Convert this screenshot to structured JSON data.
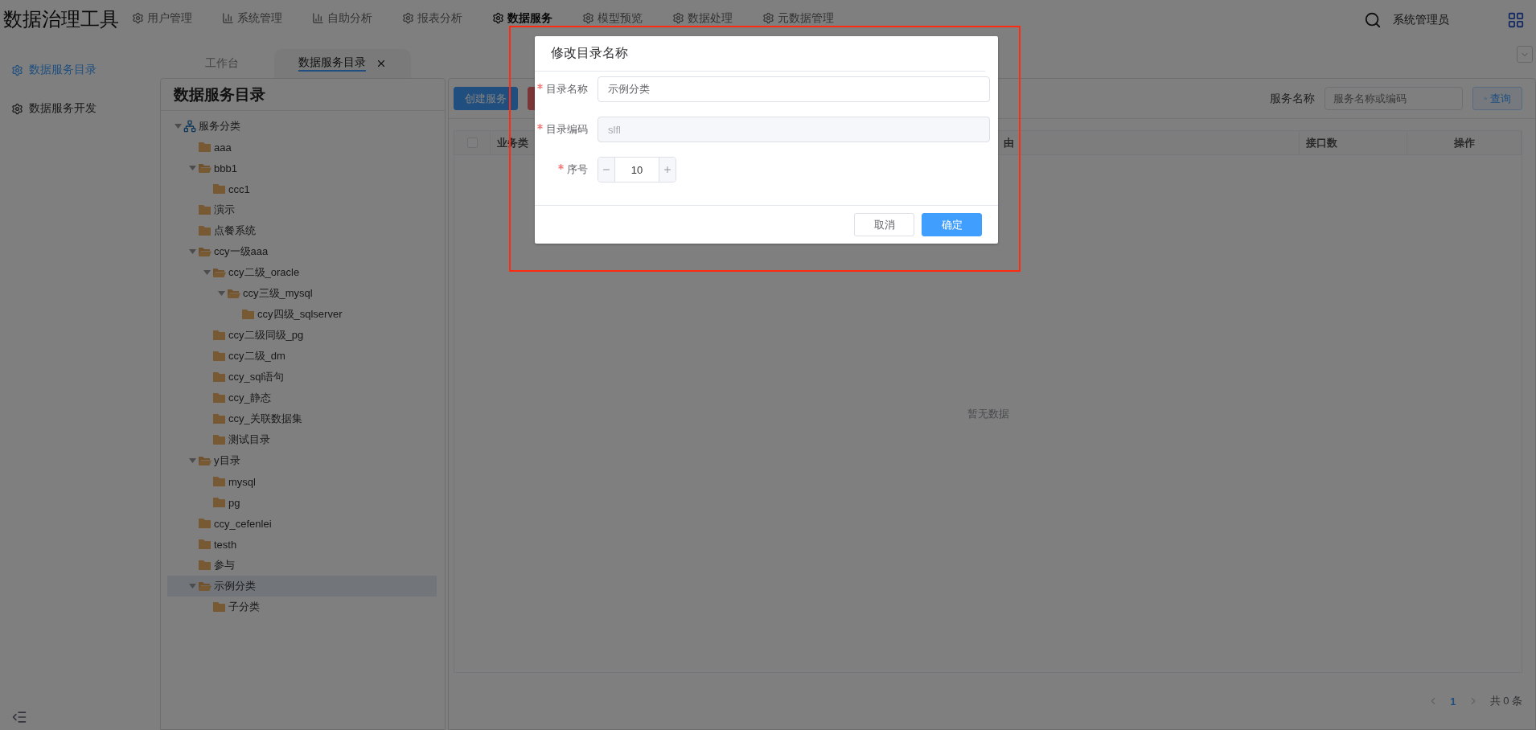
{
  "app_title": "数据治理工具",
  "nav": [
    {
      "label": "用户管理",
      "kind": "gear",
      "selected": false
    },
    {
      "label": "系统管理",
      "kind": "chart",
      "selected": false
    },
    {
      "label": "自助分析",
      "kind": "chart",
      "selected": false
    },
    {
      "label": "报表分析",
      "kind": "gear",
      "selected": false
    },
    {
      "label": "数据服务",
      "kind": "gear",
      "selected": true
    },
    {
      "label": "模型预览",
      "kind": "gear",
      "selected": false
    },
    {
      "label": "数据处理",
      "kind": "gear",
      "selected": false
    },
    {
      "label": "元数据管理",
      "kind": "gear",
      "selected": false
    }
  ],
  "header": {
    "user": "系统管理员"
  },
  "sidebar": {
    "items": [
      {
        "label": "数据服务目录",
        "selected": true
      },
      {
        "label": "数据服务开发",
        "selected": false
      }
    ]
  },
  "tabs": [
    {
      "label": "工作台",
      "selected": false,
      "closable": false
    },
    {
      "label": "数据服务目录",
      "selected": true,
      "closable": true
    }
  ],
  "tree_panel": {
    "title": "数据服务目录",
    "tree": [
      {
        "label": "服务分类",
        "kind": "root",
        "expanded": true,
        "selected": false,
        "children": [
          {
            "label": "aaa",
            "kind": "folder",
            "expanded": false,
            "selected": false
          },
          {
            "label": "bbb1",
            "kind": "folder",
            "expanded": true,
            "selected": false,
            "children": [
              {
                "label": "ccc1",
                "kind": "folder",
                "expanded": false,
                "selected": false
              }
            ]
          },
          {
            "label": "演示",
            "kind": "folder",
            "expanded": false,
            "selected": false
          },
          {
            "label": "点餐系统",
            "kind": "folder",
            "expanded": false,
            "selected": false
          },
          {
            "label": "ccy一级aaa",
            "kind": "folder",
            "expanded": true,
            "selected": false,
            "children": [
              {
                "label": "ccy二级_oracle",
                "kind": "folder",
                "expanded": true,
                "selected": false,
                "children": [
                  {
                    "label": "ccy三级_mysql",
                    "kind": "folder",
                    "expanded": true,
                    "selected": false,
                    "children": [
                      {
                        "label": "ccy四级_sqlserver",
                        "kind": "folder",
                        "expanded": false,
                        "selected": false
                      }
                    ]
                  }
                ]
              },
              {
                "label": "ccy二级同级_pg",
                "kind": "folder",
                "expanded": false,
                "selected": false
              },
              {
                "label": "ccy二级_dm",
                "kind": "folder",
                "expanded": false,
                "selected": false
              },
              {
                "label": "ccy_sql语句",
                "kind": "folder",
                "expanded": false,
                "selected": false
              },
              {
                "label": "ccy_静态",
                "kind": "folder",
                "expanded": false,
                "selected": false
              },
              {
                "label": "ccy_关联数据集",
                "kind": "folder",
                "expanded": false,
                "selected": false
              },
              {
                "label": "测试目录",
                "kind": "folder",
                "expanded": false,
                "selected": false
              }
            ]
          },
          {
            "label": "y目录",
            "kind": "folder",
            "expanded": true,
            "selected": false,
            "children": [
              {
                "label": "mysql",
                "kind": "folder",
                "expanded": false,
                "selected": false
              },
              {
                "label": "pg",
                "kind": "folder",
                "expanded": false,
                "selected": false
              }
            ]
          },
          {
            "label": "ccy_cefenlei",
            "kind": "folder",
            "expanded": false,
            "selected": false
          },
          {
            "label": "testh",
            "kind": "folder",
            "expanded": false,
            "selected": false
          },
          {
            "label": "参与",
            "kind": "folder",
            "expanded": false,
            "selected": false
          },
          {
            "label": "示例分类",
            "kind": "folder",
            "expanded": true,
            "selected": true,
            "children": [
              {
                "label": "子分类",
                "kind": "folder",
                "expanded": false,
                "selected": false
              }
            ]
          }
        ]
      }
    ]
  },
  "toolbar": {
    "buttons": [
      {
        "label": "创建服务",
        "kind": "primary"
      },
      {
        "kind": "danger"
      }
    ]
  },
  "search": {
    "label": "服务名称",
    "placeholder": "服务名称或编码",
    "button": "查询"
  },
  "table": {
    "columns": [
      {
        "kind": "checkbox",
        "checked": false
      },
      {
        "kind": "text",
        "label": "业务类"
      },
      {
        "kind": "text",
        "label": "由"
      },
      {
        "kind": "text",
        "label": "接口数"
      },
      {
        "kind": "action",
        "label": "操作"
      }
    ],
    "empty_text": "暂无数据"
  },
  "pagination": {
    "pages": [
      {
        "label": "1",
        "selected": true
      }
    ],
    "total": "共 0 条"
  },
  "dialog": {
    "title": "修改目录名称",
    "fields": [
      {
        "label": "目录名称",
        "required": true,
        "kind": "text",
        "value": "示例分类",
        "disabled": false
      },
      {
        "label": "目录编码",
        "required": true,
        "kind": "text",
        "value": "slfl",
        "disabled": true
      },
      {
        "label": "序号",
        "required": true,
        "kind": "number",
        "value": "10"
      }
    ],
    "buttons": [
      {
        "label": "取消",
        "kind": "default"
      },
      {
        "label": "确定",
        "kind": "primary"
      }
    ]
  }
}
